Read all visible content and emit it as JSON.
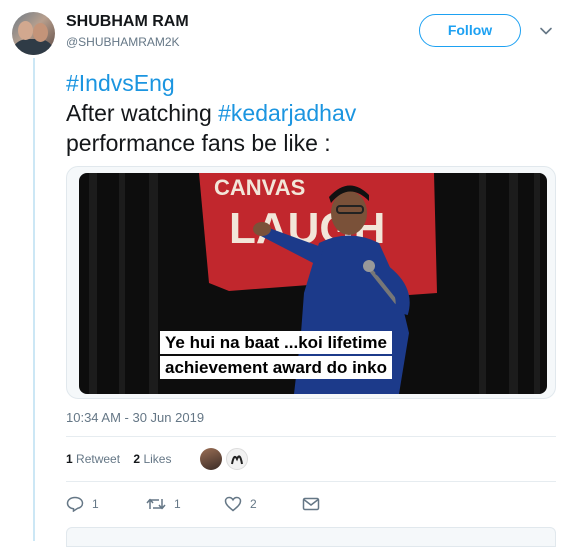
{
  "author": {
    "display_name": "SHUBHAM RAM",
    "handle": "@SHUBHAMRAM2K"
  },
  "follow_button": {
    "label": "Follow"
  },
  "tweet": {
    "hashtag_1": "#IndvsEng",
    "text_before_tag": "After watching ",
    "hashtag_2": "#kedarjadhav",
    "text_after_tag": "performance fans be like :"
  },
  "media": {
    "caption_line_1": "Ye hui na baat ...koi lifetime",
    "caption_line_2": "achievement award do inko",
    "sign_text": "CANVAS",
    "sign_text_2": "LAUGH"
  },
  "timestamp": "10:34 AM - 30 Jun 2019",
  "stats": {
    "retweets_count": "1",
    "retweets_label": "Retweet",
    "likes_count": "2",
    "likes_label": "Likes"
  },
  "actions": {
    "reply_count": "1",
    "retweet_count": "1",
    "like_count": "2"
  },
  "colors": {
    "accent": "#1da1f2",
    "hashtag": "#1b95e0",
    "muted_text": "#657786"
  }
}
